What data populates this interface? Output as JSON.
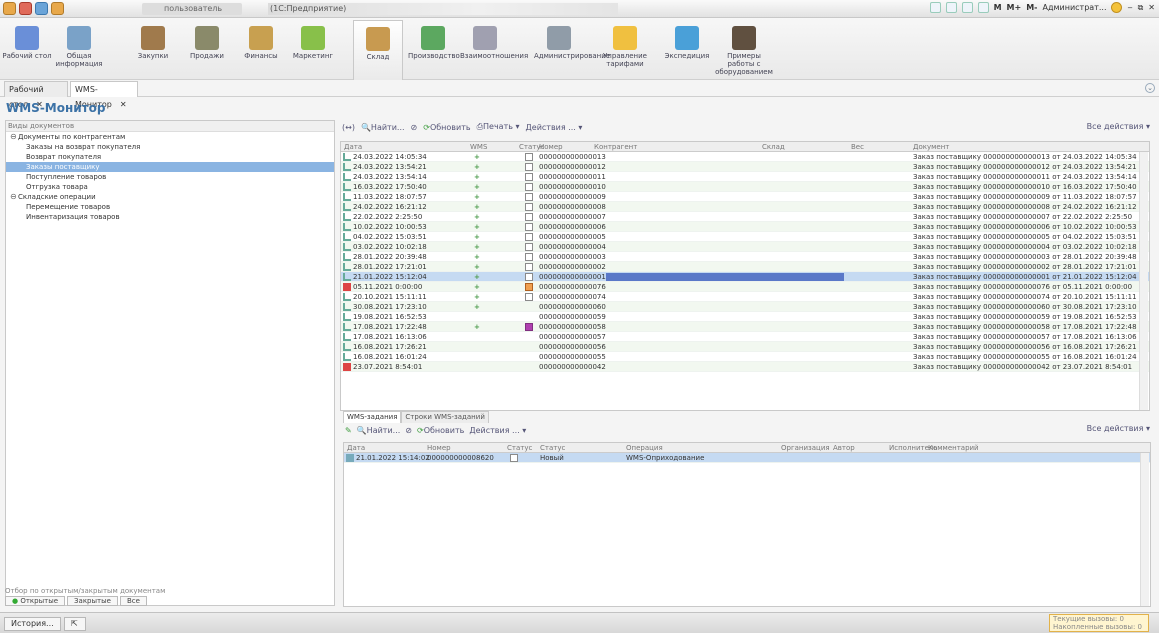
{
  "titlebar": {
    "user": "пользователь",
    "title": "(1С:Предприятие)",
    "right_items": [
      "M",
      "M+",
      "M-",
      "Администрат..."
    ]
  },
  "ribbon": [
    {
      "label": "Рабочий стол",
      "icon": "desktop-icon",
      "color": "#6a8fd8"
    },
    {
      "label": "Общая информация",
      "icon": "book-icon",
      "color": "#7aa2c8"
    },
    {
      "label": "Закупки",
      "icon": "boxes-icon",
      "color": "#a07a4c"
    },
    {
      "label": "Продажи",
      "icon": "truck-icon",
      "color": "#8a8a6a"
    },
    {
      "label": "Финансы",
      "icon": "coins-icon",
      "color": "#c8a050"
    },
    {
      "label": "Маркетинг",
      "icon": "pie-chart-icon",
      "color": "#88c04a"
    },
    {
      "label": "Склад",
      "icon": "warehouse-icon",
      "color": "#c89a50",
      "active": true
    },
    {
      "label": "Производство",
      "icon": "factory-icon",
      "color": "#5ca860"
    },
    {
      "label": "Взаимоотношения",
      "icon": "document-icon",
      "color": "#a0a0b0"
    },
    {
      "label": "Администрирование",
      "icon": "gear-icon",
      "color": "#909ca8"
    },
    {
      "label": "Управление тарифами",
      "icon": "coin-icon",
      "color": "#f0c040"
    },
    {
      "label": "Экспедиция",
      "icon": "clock-icon",
      "color": "#4aa0d8"
    },
    {
      "label": "Примеры работы с оборудованием",
      "icon": "wrench-icon",
      "color": "#605040"
    }
  ],
  "open_tabs": [
    {
      "label": "Рабочий стол"
    },
    {
      "label": "WMS-Монитор",
      "active": true
    }
  ],
  "page": {
    "title": "WMS-Монитор"
  },
  "left_panel": {
    "header": "Виды документов",
    "tree": [
      {
        "label": "Документы по контрагентам",
        "level": 0,
        "toggle": "⊖"
      },
      {
        "label": "Заказы на возврат покупателя",
        "level": 1
      },
      {
        "label": "Возврат покупателя",
        "level": 1
      },
      {
        "label": "Заказы поставщику",
        "level": 1,
        "selected": true
      },
      {
        "label": "Поступление товаров",
        "level": 1
      },
      {
        "label": "Отгрузка товара",
        "level": 1
      },
      {
        "label": "Складские операции",
        "level": 0,
        "toggle": "⊖"
      },
      {
        "label": "Перемещение товаров",
        "level": 1
      },
      {
        "label": "Инвентаризация товаров",
        "level": 1
      }
    ],
    "filter_label": "Отбор по открытым/закрытым документам",
    "filter_buttons": [
      "Открытые",
      "Закрытые",
      "Все"
    ]
  },
  "main_toolbar": {
    "find": "Найти...",
    "refresh": "Обновить",
    "print": "Печать",
    "actions": "Действия ...",
    "all_actions": "Все действия"
  },
  "main_grid": {
    "columns": [
      "Дата",
      "WMS",
      "Статус",
      "Номер",
      "Контрагент",
      "Склад",
      "Вес",
      "Документ"
    ],
    "rows": [
      {
        "date": "24.03.2022 14:05:34",
        "wms": "+",
        "status": "box",
        "num": "000000000000013",
        "doc": "Заказ поставщику 000000000000013 от 24.03.2022 14:05:34"
      },
      {
        "date": "24.03.2022 13:54:21",
        "wms": "+",
        "status": "box",
        "num": "000000000000012",
        "doc": "Заказ поставщику 000000000000012 от 24.03.2022 13:54:21"
      },
      {
        "date": "24.03.2022 13:54:14",
        "wms": "+",
        "status": "box",
        "num": "000000000000011",
        "doc": "Заказ поставщику 000000000000011 от 24.03.2022 13:54:14"
      },
      {
        "date": "16.03.2022 17:50:40",
        "wms": "+",
        "status": "box",
        "num": "000000000000010",
        "doc": "Заказ поставщику 000000000000010 от 16.03.2022 17:50:40"
      },
      {
        "date": "11.03.2022 18:07:57",
        "wms": "+",
        "status": "box",
        "num": "000000000000009",
        "doc": "Заказ поставщику 000000000000009 от 11.03.2022 18:07:57"
      },
      {
        "date": "24.02.2022 16:21:12",
        "wms": "+",
        "status": "box",
        "num": "000000000000008",
        "doc": "Заказ поставщику 000000000000008 от 24.02.2022 16:21:12"
      },
      {
        "date": "22.02.2022 2:25:50",
        "wms": "+",
        "status": "box",
        "num": "000000000000007",
        "doc": "Заказ поставщику 000000000000007 от 22.02.2022 2:25:50"
      },
      {
        "date": "10.02.2022 10:00:53",
        "wms": "+",
        "status": "box",
        "num": "000000000000006",
        "doc": "Заказ поставщику 000000000000006 от 10.02.2022 10:00:53"
      },
      {
        "date": "04.02.2022 15:03:51",
        "wms": "+",
        "status": "box",
        "num": "000000000000005",
        "doc": "Заказ поставщику 000000000000005 от 04.02.2022 15:03:51"
      },
      {
        "date": "03.02.2022 10:02:18",
        "wms": "+",
        "status": "box",
        "num": "000000000000004",
        "doc": "Заказ поставщику 000000000000004 от 03.02.2022 10:02:18"
      },
      {
        "date": "28.01.2022 20:39:48",
        "wms": "+",
        "status": "box",
        "num": "000000000000003",
        "doc": "Заказ поставщику 000000000000003 от 28.01.2022 20:39:48"
      },
      {
        "date": "28.01.2022 17:21:01",
        "wms": "+",
        "status": "box",
        "num": "000000000000002",
        "doc": "Заказ поставщику 000000000000002 от 28.01.2022 17:21:01"
      },
      {
        "date": "21.01.2022 15:12:04",
        "wms": "+",
        "status": "box",
        "num": "000000000000001",
        "doc": "Заказ поставщику 000000000000001 от 21.01.2022 15:12:04",
        "selected": true
      },
      {
        "date": "05.11.2021 0:00:00",
        "wms": "+",
        "status": "orange",
        "num": "000000000000076",
        "doc": "Заказ поставщику 000000000000076 от 05.11.2021 0:00:00",
        "bad": true
      },
      {
        "date": "20.10.2021 15:11:11",
        "wms": "+",
        "status": "box",
        "num": "000000000000074",
        "doc": "Заказ поставщику 000000000000074 от 20.10.2021 15:11:11"
      },
      {
        "date": "30.08.2021 17:23:10",
        "wms": "+",
        "status": "",
        "num": "000000000000060",
        "doc": "Заказ поставщику 000000000000060 от 30.08.2021 17:23:10"
      },
      {
        "date": "19.08.2021 16:52:53",
        "wms": "",
        "status": "",
        "num": "000000000000059",
        "doc": "Заказ поставщику 000000000000059 от 19.08.2021 16:52:53"
      },
      {
        "date": "17.08.2021 17:22:48",
        "wms": "+",
        "status": "purple",
        "num": "000000000000058",
        "doc": "Заказ поставщику 000000000000058 от 17.08.2021 17:22:48"
      },
      {
        "date": "17.08.2021 16:13:06",
        "wms": "",
        "status": "",
        "num": "000000000000057",
        "doc": "Заказ поставщику 000000000000057 от 17.08.2021 16:13:06"
      },
      {
        "date": "16.08.2021 17:26:21",
        "wms": "",
        "status": "",
        "num": "000000000000056",
        "doc": "Заказ поставщику 000000000000056 от 16.08.2021 17:26:21"
      },
      {
        "date": "16.08.2021 16:01:24",
        "wms": "",
        "status": "",
        "num": "000000000000055",
        "doc": "Заказ поставщику 000000000000055 от 16.08.2021 16:01:24"
      },
      {
        "date": "23.07.2021 8:54:01",
        "wms": "",
        "status": "",
        "num": "000000000000042",
        "doc": "Заказ поставщику 000000000000042 от 23.07.2021 8:54:01",
        "bad": true
      }
    ]
  },
  "subtabs": [
    "WMS-задания",
    "Строки WMS-заданий"
  ],
  "sub_toolbar": {
    "find": "Найти...",
    "refresh": "Обновить",
    "actions": "Действия ...",
    "all_actions": "Все действия"
  },
  "sub_grid": {
    "columns": [
      "Дата",
      "Номер",
      "Статус",
      "Статус",
      "Операция",
      "Организация",
      "Автор",
      "Исполнитель",
      "Комментарий"
    ],
    "rows": [
      {
        "date": "21.01.2022 15:14:02",
        "num": "000000000008620",
        "status": "Новый",
        "op": "WMS-Оприходование"
      }
    ]
  },
  "statusbar": {
    "history": "История...",
    "calls_current": "Текущие вызовы: 0",
    "calls_total": "Накопленные вызовы: 0"
  }
}
